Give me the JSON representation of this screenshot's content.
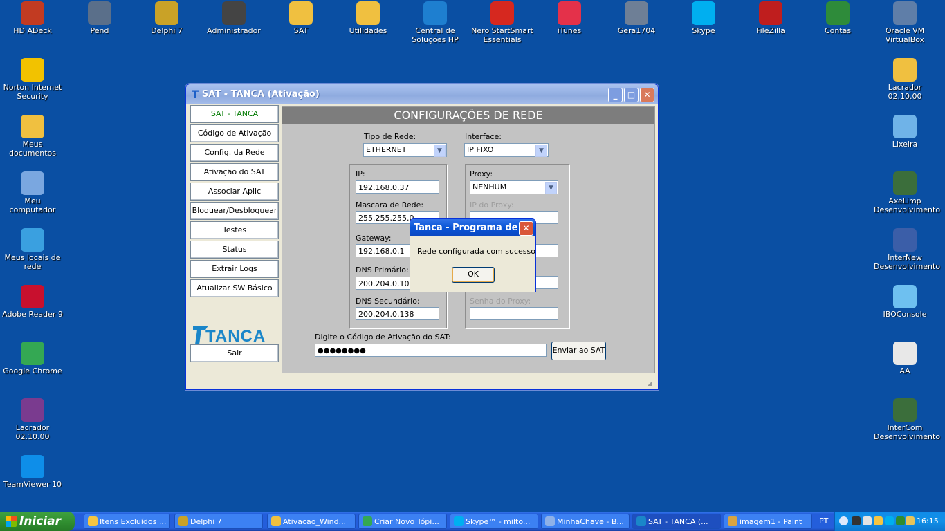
{
  "desktop": {
    "icons": [
      {
        "label": "HD ADeck",
        "color": "#c23b22"
      },
      {
        "label": "Pend",
        "color": "#5a6f8a"
      },
      {
        "label": "Delphi 7",
        "color": "#c9a227"
      },
      {
        "label": "Administrador",
        "color": "#444444"
      },
      {
        "label": "SAT",
        "color": "#f0c040"
      },
      {
        "label": "Utilidades",
        "color": "#f0c040"
      },
      {
        "label": "Central de Soluções HP",
        "color": "#1e7fd0"
      },
      {
        "label": "Nero StartSmart Essentials",
        "color": "#d6281f"
      },
      {
        "label": "iTunes",
        "color": "#e4314a"
      },
      {
        "label": "Gera1704",
        "color": "#6e7f96"
      },
      {
        "label": "Skype",
        "color": "#00aff0"
      },
      {
        "label": "FileZilla",
        "color": "#bf1e1e"
      },
      {
        "label": "Contas",
        "color": "#2e8b3a"
      },
      {
        "label": "Oracle VM VirtualBox",
        "color": "#5f7ea8"
      },
      {
        "label": "Norton Internet Security",
        "color": "#f2c200"
      },
      {
        "label": "Meus documentos",
        "color": "#f0c040"
      },
      {
        "label": "Meu computador",
        "color": "#7aa7e0"
      },
      {
        "label": "Meus locais de rede",
        "color": "#3aa0e0"
      },
      {
        "label": "Adobe Reader 9",
        "color": "#c8102e"
      },
      {
        "label": "Google Chrome",
        "color": "#34a853"
      },
      {
        "label": "Lacrador 02.10.00",
        "color": "#7a3b8f"
      },
      {
        "label": "TeamViewer 10",
        "color": "#0e8ee9"
      },
      {
        "label": "Lacrador 02.10.00",
        "color": "#f0c040"
      },
      {
        "label": "Lixeira",
        "color": "#6fb3e8"
      },
      {
        "label": "AxeLimp Desenvolvimento",
        "color": "#3b6e3b"
      },
      {
        "label": "InterNew Desenvolvimento",
        "color": "#3b5ea8"
      },
      {
        "label": "IBOConsole",
        "color": "#6ec0f0"
      },
      {
        "label": "AA",
        "color": "#e8e8e8"
      },
      {
        "label": "InterCom Desenvolvimento",
        "color": "#3b6e3b"
      }
    ]
  },
  "window": {
    "title": "SAT - TANCA (Ativação)",
    "title_icon": "T",
    "sidebar": {
      "items": [
        "SAT - TANCA",
        "Código de Ativação",
        "Config. da Rede",
        "Ativação do SAT",
        "Associar Aplic Comercial",
        "Bloquear/Desbloquear",
        "Testes",
        "Status",
        "Extrair Logs",
        "Atualizar SW Básico"
      ],
      "logo": "TANCA",
      "exit": "Sair"
    },
    "panel": {
      "title": "CONFIGURAÇÕES DE REDE",
      "tipo_rede_label": "Tipo de Rede:",
      "tipo_rede_value": "ETHERNET",
      "interface_label": "Interface:",
      "interface_value": "IP FIXO",
      "ip_label": "IP:",
      "ip_value": "192.168.0.37",
      "mascara_label": "Mascara de Rede:",
      "mascara_value": "255.255.255.0",
      "gateway_label": "Gateway:",
      "gateway_value": "192.168.0.1",
      "dns1_label": "DNS Primário:",
      "dns1_value": "200.204.0.10",
      "dns2_label": "DNS Secundário:",
      "dns2_value": "200.204.0.138",
      "proxy_label": "Proxy:",
      "proxy_value": "NENHUM",
      "ip_proxy_label": "IP do Proxy:",
      "senha_proxy_label": "Senha do Proxy:",
      "codigo_label": "Digite o Código de Ativação do SAT:",
      "codigo_value": "●●●●●●●●",
      "enviar_label": "Enviar ao SAT"
    }
  },
  "dialog": {
    "title": "Tanca - Programa de ...",
    "message": "Rede configurada com sucesso",
    "ok": "OK",
    "close": "✕"
  },
  "taskbar": {
    "start": "Iniciar",
    "tasks": [
      {
        "label": "Itens Excluídos ...",
        "color": "#f5c542"
      },
      {
        "label": "Delphi 7",
        "color": "#c9a227"
      },
      {
        "label": "Ativacao_Wind...",
        "color": "#f0c040"
      },
      {
        "label": "Criar Novo Tópi...",
        "color": "#34a853"
      },
      {
        "label": "Skype™ - milto...",
        "color": "#00aff0"
      },
      {
        "label": "MinhaChave - B...",
        "color": "#8fb1e8"
      },
      {
        "label": "SAT - TANCA (...",
        "color": "#1a86c9"
      },
      {
        "label": "imagem1 - Paint",
        "color": "#d9a441"
      }
    ],
    "language": "PT",
    "clock": "16:15"
  }
}
